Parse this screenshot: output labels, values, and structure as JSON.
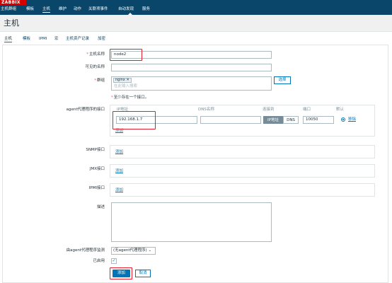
{
  "logo": "ZABBIX",
  "topnav": {
    "items": [
      "主机群组",
      "模板",
      "主机",
      "维护",
      "动作",
      "关联项事件",
      "自动发现",
      "服务"
    ]
  },
  "page_title": "主机",
  "tabs": [
    "主机",
    "模板",
    "IPMI",
    "宏",
    "主机资产记录",
    "加密"
  ],
  "form": {
    "host_name_label": "主机名称",
    "host_name_value": "node2",
    "visible_name_label": "可见的名称",
    "visible_name_value": "",
    "groups_label": "群组",
    "group_chip": "nginx",
    "group_search_placeholder": "在此输入搜索",
    "select_button": "选择",
    "interface_note": "至少存在一个接口。",
    "agent_label": "agent代理程序的接口",
    "col_ip": "IP地址",
    "col_dns": "DNS名称",
    "col_connect": "连接到",
    "col_port": "端口",
    "col_default": "默认",
    "ip_value": "192.168.1.7",
    "dns_value": "",
    "seg_ip": "IP地址",
    "seg_dns": "DNS",
    "port_value": "10050",
    "remove_link": "移除",
    "add_link": "添加",
    "snmp_label": "SNMP接口",
    "jmx_label": "JMX接口",
    "ipmi_label": "IPMI接口",
    "description_label": "描述",
    "proxy_label": "由agent代理程序监测",
    "proxy_value": "(无agent代理程序)",
    "enabled_label": "已启用",
    "submit_button": "添加",
    "cancel_button": "取消"
  },
  "colors": {
    "nav_bg": "#0a466a",
    "accent": "#0275b8",
    "highlight": "#e0202d"
  }
}
